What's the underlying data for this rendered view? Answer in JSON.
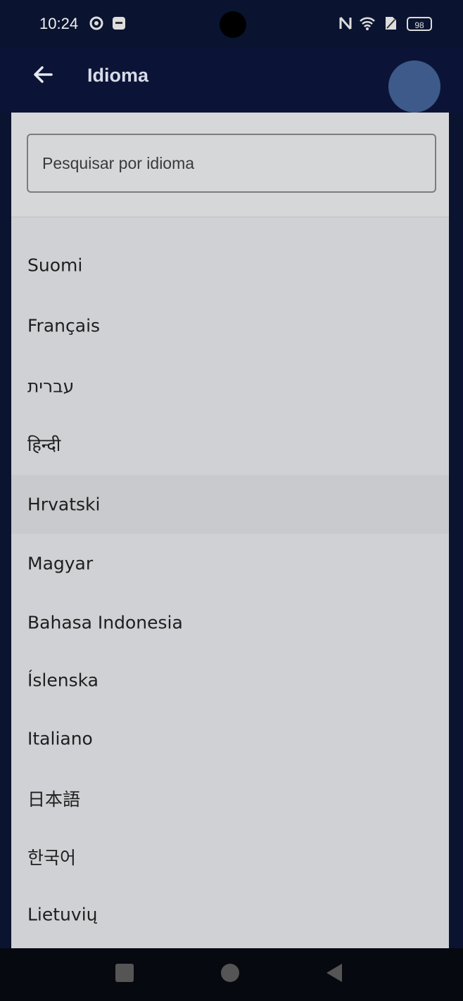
{
  "status_bar": {
    "time": "10:24",
    "battery": "98",
    "icons": [
      "settings-icon",
      "app-icon",
      "nfc-icon",
      "wifi-icon",
      "no-sim-icon",
      "battery-icon"
    ]
  },
  "app_bar": {
    "title": "Idioma",
    "back_icon": "arrow-left-icon",
    "avatar_color": "#3d5a8a"
  },
  "search": {
    "placeholder": "Pesquisar por idioma",
    "value": ""
  },
  "languages": [
    "Suomi",
    "Français",
    "עברית",
    "हिन्दी",
    "Hrvatski",
    "Magyar",
    "Bahasa Indonesia",
    "Íslenska",
    "Italiano",
    "日本語",
    "한국어",
    "Lietuvių"
  ],
  "nav_bar": {
    "recents_icon": "square-icon",
    "home_icon": "circle-icon",
    "back_icon": "triangle-back-icon"
  }
}
